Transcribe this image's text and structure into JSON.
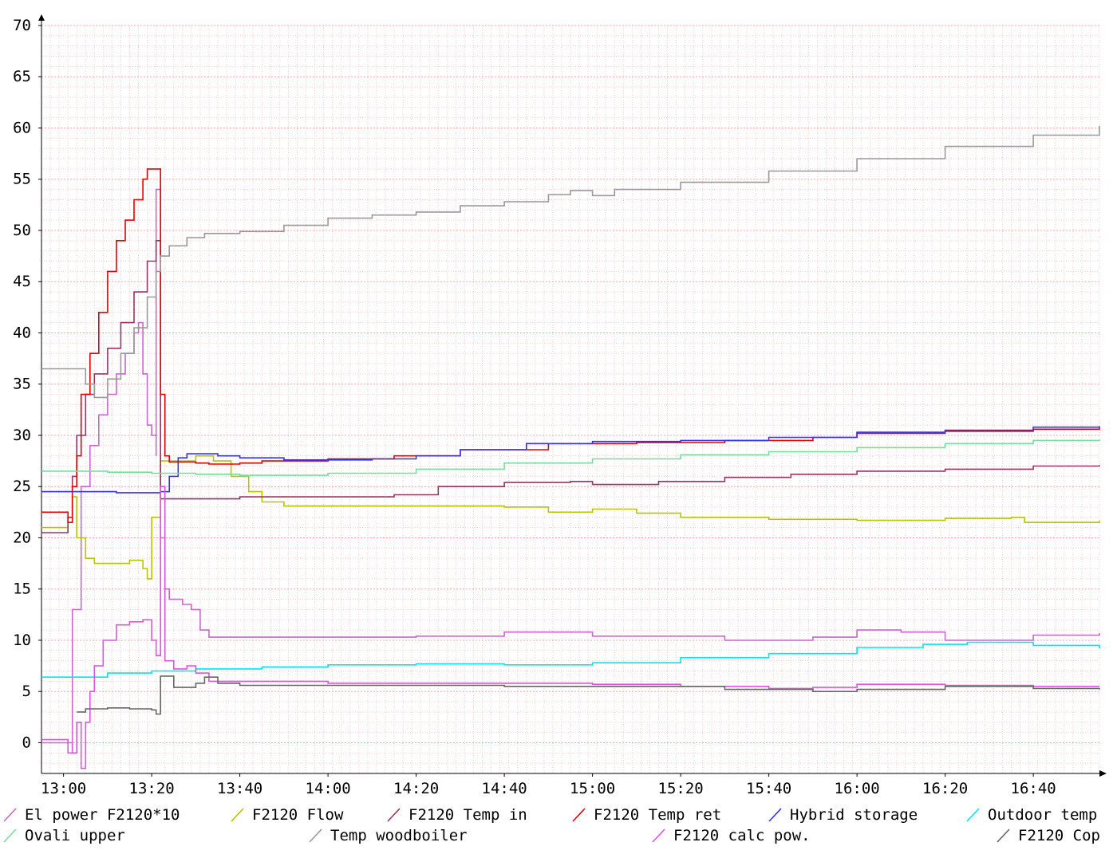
{
  "chart_data": {
    "type": "line",
    "title": "",
    "xlabel": "",
    "ylabel": "",
    "xlim": [
      "12:55",
      "16:55"
    ],
    "ylim": [
      -3,
      70
    ],
    "grid": true,
    "x_ticks": [
      "13:00",
      "13:20",
      "13:40",
      "14:00",
      "14:20",
      "14:40",
      "15:00",
      "15:20",
      "15:40",
      "16:00",
      "16:20",
      "16:40"
    ],
    "y_ticks": [
      0,
      5,
      10,
      15,
      20,
      25,
      30,
      35,
      40,
      45,
      50,
      55,
      60,
      65,
      70
    ],
    "legend_position": "bottom",
    "series": [
      {
        "name": "El power F2120*10",
        "color": "#cc66cc",
        "points": [
          [
            "12:55",
            0
          ],
          [
            "13:00",
            0
          ],
          [
            "13:01",
            -1
          ],
          [
            "13:02",
            13
          ],
          [
            "13:04",
            25
          ],
          [
            "13:06",
            29
          ],
          [
            "13:08",
            32
          ],
          [
            "13:10",
            34
          ],
          [
            "13:12",
            36
          ],
          [
            "13:14",
            38
          ],
          [
            "13:16",
            40
          ],
          [
            "13:17",
            41
          ],
          [
            "13:18",
            36
          ],
          [
            "13:19",
            31
          ],
          [
            "13:20",
            30
          ],
          [
            "13:21",
            28
          ],
          [
            "13:21",
            54
          ],
          [
            "13:22",
            20
          ],
          [
            "13:23",
            15
          ],
          [
            "13:24",
            14
          ],
          [
            "13:27",
            13.5
          ],
          [
            "13:29",
            13
          ],
          [
            "13:31",
            11
          ],
          [
            "13:33",
            10.3
          ],
          [
            "14:00",
            10.3
          ],
          [
            "14:20",
            10.4
          ],
          [
            "14:40",
            10.8
          ],
          [
            "15:00",
            10.4
          ],
          [
            "15:30",
            10
          ],
          [
            "15:50",
            10.3
          ],
          [
            "16:00",
            11
          ],
          [
            "16:10",
            10.8
          ],
          [
            "16:20",
            10
          ],
          [
            "16:40",
            10.5
          ],
          [
            "16:55",
            10.7
          ]
        ]
      },
      {
        "name": "F2120 Flow",
        "color": "#b8c400",
        "points": [
          [
            "12:55",
            21
          ],
          [
            "13:00",
            21
          ],
          [
            "13:01",
            22
          ],
          [
            "13:02",
            24
          ],
          [
            "13:03",
            20
          ],
          [
            "13:05",
            18
          ],
          [
            "13:07",
            17.5
          ],
          [
            "13:10",
            17.5
          ],
          [
            "13:15",
            17.8
          ],
          [
            "13:18",
            17
          ],
          [
            "13:19",
            16
          ],
          [
            "13:20",
            22
          ],
          [
            "13:22",
            27.5
          ],
          [
            "13:25",
            27.5
          ],
          [
            "13:30",
            28
          ],
          [
            "13:34",
            27.5
          ],
          [
            "13:38",
            26
          ],
          [
            "13:42",
            24.5
          ],
          [
            "13:45",
            23.5
          ],
          [
            "13:50",
            23.1
          ],
          [
            "14:00",
            23.1
          ],
          [
            "14:20",
            23.1
          ],
          [
            "14:40",
            23
          ],
          [
            "14:50",
            22.5
          ],
          [
            "15:00",
            22.8
          ],
          [
            "15:10",
            22.4
          ],
          [
            "15:20",
            22
          ],
          [
            "15:40",
            21.8
          ],
          [
            "16:00",
            21.7
          ],
          [
            "16:20",
            21.9
          ],
          [
            "16:35",
            22
          ],
          [
            "16:38",
            21.5
          ],
          [
            "16:55",
            21.7
          ]
        ]
      },
      {
        "name": "F2120 Temp in",
        "color": "#993366",
        "points": [
          [
            "12:55",
            20.5
          ],
          [
            "13:00",
            20.5
          ],
          [
            "13:01",
            22
          ],
          [
            "13:02",
            26
          ],
          [
            "13:03",
            30
          ],
          [
            "13:05",
            34
          ],
          [
            "13:07",
            36
          ],
          [
            "13:10",
            38.5
          ],
          [
            "13:13",
            41
          ],
          [
            "13:16",
            44
          ],
          [
            "13:19",
            47
          ],
          [
            "13:21",
            49
          ],
          [
            "13:22",
            23.8
          ],
          [
            "13:30",
            23.8
          ],
          [
            "13:40",
            24
          ],
          [
            "13:55",
            24
          ],
          [
            "14:15",
            24.2
          ],
          [
            "14:25",
            25
          ],
          [
            "14:40",
            25.4
          ],
          [
            "14:55",
            25.5
          ],
          [
            "15:00",
            25.2
          ],
          [
            "15:15",
            25.5
          ],
          [
            "15:30",
            25.9
          ],
          [
            "15:45",
            26.2
          ],
          [
            "16:00",
            26.5
          ],
          [
            "16:20",
            26.7
          ],
          [
            "16:40",
            27
          ],
          [
            "16:55",
            27.1
          ]
        ]
      },
      {
        "name": "F2120 Temp ret",
        "color": "#e60000",
        "points": [
          [
            "12:55",
            22.5
          ],
          [
            "13:00",
            22.5
          ],
          [
            "13:01",
            21.5
          ],
          [
            "13:02",
            25
          ],
          [
            "13:03",
            28
          ],
          [
            "13:04",
            34
          ],
          [
            "13:06",
            38
          ],
          [
            "13:08",
            42
          ],
          [
            "13:10",
            46
          ],
          [
            "13:12",
            49
          ],
          [
            "13:14",
            51
          ],
          [
            "13:16",
            53
          ],
          [
            "13:18",
            55
          ],
          [
            "13:19",
            56
          ],
          [
            "13:21",
            56
          ],
          [
            "13:22",
            34
          ],
          [
            "13:23",
            28
          ],
          [
            "13:24",
            27.4
          ],
          [
            "13:30",
            27.3
          ],
          [
            "13:33",
            27.2
          ],
          [
            "13:40",
            27.3
          ],
          [
            "13:45",
            27.5
          ],
          [
            "14:00",
            27.7
          ],
          [
            "14:15",
            28
          ],
          [
            "14:30",
            28.6
          ],
          [
            "14:50",
            29.2
          ],
          [
            "15:10",
            29.3
          ],
          [
            "15:30",
            29.5
          ],
          [
            "15:50",
            29.8
          ],
          [
            "16:00",
            30.2
          ],
          [
            "16:20",
            30.4
          ],
          [
            "16:40",
            30.6
          ],
          [
            "16:55",
            30.8
          ]
        ]
      },
      {
        "name": "Hybrid storage",
        "color": "#3333ee",
        "points": [
          [
            "12:55",
            24.5
          ],
          [
            "13:00",
            24.5
          ],
          [
            "13:10",
            24.5
          ],
          [
            "13:12",
            24.4
          ],
          [
            "13:20",
            24.4
          ],
          [
            "13:22",
            24.5
          ],
          [
            "13:24",
            26
          ],
          [
            "13:26",
            27.8
          ],
          [
            "13:28",
            28.2
          ],
          [
            "13:35",
            28
          ],
          [
            "13:40",
            27.8
          ],
          [
            "13:50",
            27.6
          ],
          [
            "14:00",
            27.6
          ],
          [
            "14:10",
            27.7
          ],
          [
            "14:20",
            28
          ],
          [
            "14:30",
            28.6
          ],
          [
            "14:45",
            29.2
          ],
          [
            "15:00",
            29.4
          ],
          [
            "15:20",
            29.5
          ],
          [
            "15:40",
            29.8
          ],
          [
            "16:00",
            30.3
          ],
          [
            "16:20",
            30.5
          ],
          [
            "16:40",
            30.8
          ],
          [
            "16:55",
            30.9
          ]
        ]
      },
      {
        "name": "Outdoor temp",
        "color": "#00e5ee",
        "points": [
          [
            "12:55",
            6.4
          ],
          [
            "13:00",
            6.4
          ],
          [
            "13:10",
            6.8
          ],
          [
            "13:20",
            7
          ],
          [
            "13:30",
            7.2
          ],
          [
            "13:45",
            7.4
          ],
          [
            "14:00",
            7.6
          ],
          [
            "14:20",
            7.7
          ],
          [
            "14:40",
            7.6
          ],
          [
            "15:00",
            7.8
          ],
          [
            "15:20",
            8.3
          ],
          [
            "15:40",
            8.7
          ],
          [
            "16:00",
            9.3
          ],
          [
            "16:15",
            9.6
          ],
          [
            "16:25",
            9.8
          ],
          [
            "16:40",
            9.5
          ],
          [
            "16:55",
            9.2
          ]
        ]
      },
      {
        "name": "Ovali upper",
        "color": "#77dd99",
        "points": [
          [
            "12:55",
            26.5
          ],
          [
            "13:00",
            26.5
          ],
          [
            "13:10",
            26.4
          ],
          [
            "13:20",
            26.3
          ],
          [
            "13:30",
            26.2
          ],
          [
            "13:40",
            26.1
          ],
          [
            "14:00",
            26.3
          ],
          [
            "14:20",
            26.7
          ],
          [
            "14:40",
            27.3
          ],
          [
            "15:00",
            27.7
          ],
          [
            "15:20",
            28.1
          ],
          [
            "15:40",
            28.4
          ],
          [
            "16:00",
            28.8
          ],
          [
            "16:20",
            29.2
          ],
          [
            "16:40",
            29.5
          ],
          [
            "16:55",
            29.6
          ]
        ]
      },
      {
        "name": "Temp woodboiler",
        "color": "#999999",
        "points": [
          [
            "12:55",
            36.5
          ],
          [
            "13:00",
            36.5
          ],
          [
            "13:03",
            36.5
          ],
          [
            "13:05",
            35
          ],
          [
            "13:07",
            33.7
          ],
          [
            "13:10",
            35.5
          ],
          [
            "13:13",
            38
          ],
          [
            "13:16",
            40.5
          ],
          [
            "13:19",
            43.5
          ],
          [
            "13:21",
            46
          ],
          [
            "13:22",
            47.5
          ],
          [
            "13:24",
            48.5
          ],
          [
            "13:28",
            49.3
          ],
          [
            "13:32",
            49.7
          ],
          [
            "13:40",
            49.9
          ],
          [
            "13:50",
            50.5
          ],
          [
            "14:00",
            51.2
          ],
          [
            "14:10",
            51.5
          ],
          [
            "14:20",
            51.8
          ],
          [
            "14:30",
            52.4
          ],
          [
            "14:40",
            52.8
          ],
          [
            "14:50",
            53.5
          ],
          [
            "14:55",
            53.9
          ],
          [
            "15:00",
            53.4
          ],
          [
            "15:05",
            54
          ],
          [
            "15:20",
            54.7
          ],
          [
            "15:40",
            55.8
          ],
          [
            "16:00",
            57
          ],
          [
            "16:20",
            58.2
          ],
          [
            "16:40",
            59.3
          ],
          [
            "16:55",
            60.2
          ]
        ]
      },
      {
        "name": "F2120 calc pow.",
        "color": "#dd55dd",
        "points": [
          [
            "12:55",
            0.3
          ],
          [
            "13:00",
            0.3
          ],
          [
            "13:01",
            0
          ],
          [
            "13:02",
            -1
          ],
          [
            "13:03",
            2
          ],
          [
            "13:04",
            -2.5
          ],
          [
            "13:05",
            2
          ],
          [
            "13:06",
            5
          ],
          [
            "13:07",
            7.5
          ],
          [
            "13:09",
            10
          ],
          [
            "13:12",
            11.5
          ],
          [
            "13:15",
            11.8
          ],
          [
            "13:18",
            12
          ],
          [
            "13:20",
            10
          ],
          [
            "13:21",
            8.5
          ],
          [
            "13:22",
            25
          ],
          [
            "13:23",
            8
          ],
          [
            "13:25",
            7.2
          ],
          [
            "13:28",
            7.5
          ],
          [
            "13:30",
            6.8
          ],
          [
            "13:33",
            6
          ],
          [
            "14:00",
            5.8
          ],
          [
            "14:40",
            5.8
          ],
          [
            "15:00",
            5.7
          ],
          [
            "15:20",
            5.5
          ],
          [
            "15:40",
            5.3
          ],
          [
            "15:50",
            5.4
          ],
          [
            "16:00",
            5.7
          ],
          [
            "16:20",
            5.6
          ],
          [
            "16:40",
            5.5
          ],
          [
            "16:55",
            5.5
          ]
        ]
      },
      {
        "name": "F2120 Cop",
        "color": "#666666",
        "points": [
          [
            "13:03",
            3
          ],
          [
            "13:05",
            3.3
          ],
          [
            "13:10",
            3.4
          ],
          [
            "13:15",
            3.3
          ],
          [
            "13:20",
            3.2
          ],
          [
            "13:21",
            2.8
          ],
          [
            "13:22",
            6.5
          ],
          [
            "13:25",
            5.4
          ],
          [
            "13:30",
            5.8
          ],
          [
            "13:32",
            6.4
          ],
          [
            "13:35",
            5.8
          ],
          [
            "13:40",
            5.6
          ],
          [
            "14:00",
            5.6
          ],
          [
            "14:40",
            5.5
          ],
          [
            "15:00",
            5.5
          ],
          [
            "15:30",
            5.2
          ],
          [
            "15:50",
            5
          ],
          [
            "16:00",
            5.2
          ],
          [
            "16:20",
            5.5
          ],
          [
            "16:40",
            5.3
          ],
          [
            "16:55",
            5.2
          ]
        ]
      }
    ]
  }
}
